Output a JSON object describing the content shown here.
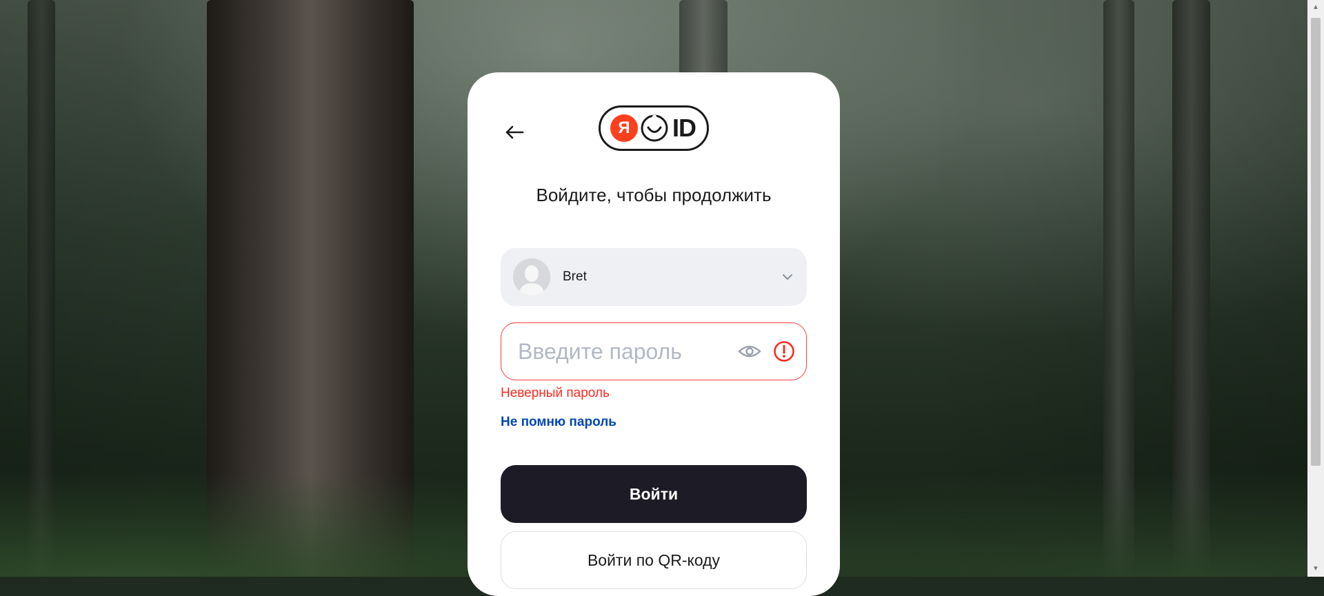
{
  "logo": {
    "ya": "Я",
    "id_text": "ID"
  },
  "title": "Войдите, чтобы продолжить",
  "account": {
    "name": "Bret"
  },
  "password": {
    "placeholder": "Введите пароль",
    "value": ""
  },
  "error": "Неверный пароль",
  "forgot_link": "Не помню пароль",
  "login_button": "Войти",
  "qr_button": "Войти по QR-коду",
  "colors": {
    "brand_red": "#fc3f1d",
    "error_red": "#ff2a1f",
    "link_blue": "#0047b3",
    "primary_button": "#1d1c26"
  }
}
